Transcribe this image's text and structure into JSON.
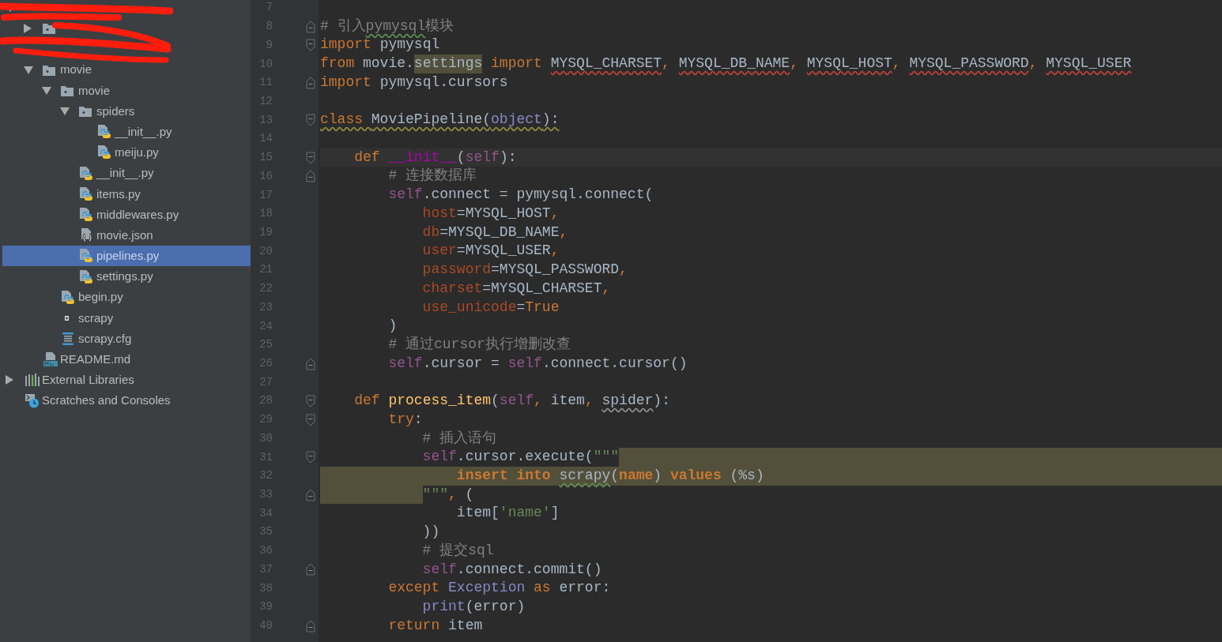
{
  "sidebar": {
    "redacted": true,
    "tree": [
      {
        "kind": "redacted",
        "expanded": true,
        "children": [
          {
            "kind": "folder",
            "expanded": false
          },
          {
            "kind": "redacted"
          },
          {
            "kind": "folder",
            "label": "movie",
            "expanded": true,
            "selected": false,
            "children": [
              {
                "kind": "folder",
                "label": "movie",
                "expanded": true,
                "selected": false,
                "children": [
                  {
                    "kind": "folder",
                    "label": "spiders",
                    "expanded": true,
                    "selected": false,
                    "children": [
                      {
                        "kind": "python",
                        "label": "__init__.py",
                        "selected": false
                      },
                      {
                        "kind": "python",
                        "label": "meiju.py",
                        "selected": false
                      }
                    ]
                  },
                  {
                    "kind": "python",
                    "label": "__init__.py",
                    "selected": false
                  },
                  {
                    "kind": "python",
                    "label": "items.py",
                    "selected": false
                  },
                  {
                    "kind": "python",
                    "label": "middlewares.py",
                    "selected": false
                  },
                  {
                    "kind": "json",
                    "label": "movie.json",
                    "selected": false
                  },
                  {
                    "kind": "python",
                    "label": "pipelines.py",
                    "selected": true
                  },
                  {
                    "kind": "python",
                    "label": "settings.py",
                    "selected": false
                  }
                ]
              },
              {
                "kind": "python",
                "label": "begin.py",
                "selected": false
              },
              {
                "kind": "file",
                "label": "scrapy",
                "selected": false
              },
              {
                "kind": "config",
                "label": "scrapy.cfg",
                "selected": false
              }
            ]
          },
          {
            "kind": "markdown",
            "label": "README.md",
            "selected": false
          }
        ]
      },
      {
        "kind": "libraries",
        "label": "External Libraries",
        "expanded": false,
        "selected": false
      },
      {
        "kind": "scratches",
        "label": "Scratches and Consoles",
        "selected": false
      }
    ]
  },
  "editor": {
    "lines": [
      {
        "number": "7"
      },
      {
        "number": "8",
        "fold_end": true,
        "tokens": [
          {
            "text": "# 引入",
            "kind": "comment"
          },
          {
            "text": "pymysql",
            "kind": "comment",
            "typo": true
          },
          {
            "text": "模块",
            "kind": "comment"
          }
        ]
      },
      {
        "number": "9",
        "fold_start": true,
        "tokens": [
          {
            "text": "import ",
            "kind": "kw"
          },
          {
            "text": "pymysql",
            "kind": "plain"
          }
        ]
      },
      {
        "number": "10",
        "tokens": [
          {
            "text": "from ",
            "kind": "kw"
          },
          {
            "text": "movie.",
            "kind": "plain"
          },
          {
            "text": "settings",
            "kind": "plain",
            "hl": true
          },
          {
            "text": " import ",
            "kind": "kw"
          },
          {
            "text": "MYSQL_CHARSET",
            "kind": "plain",
            "error": true
          },
          {
            "text": ", ",
            "kind": "kw"
          },
          {
            "text": "MYSQL_DB_NAME",
            "kind": "plain",
            "error": true
          },
          {
            "text": ", ",
            "kind": "kw"
          },
          {
            "text": "MYSQL_HOST",
            "kind": "plain",
            "error": true
          },
          {
            "text": ", ",
            "kind": "kw"
          },
          {
            "text": "MYSQL_PASSWORD",
            "kind": "plain",
            "error": true
          },
          {
            "text": ", ",
            "kind": "kw"
          },
          {
            "text": "MYSQL_USER",
            "kind": "plain",
            "error": true
          }
        ]
      },
      {
        "number": "11",
        "fold_end": true,
        "tokens": [
          {
            "text": "import ",
            "kind": "kw"
          },
          {
            "text": "pymysql.cursors",
            "kind": "plain"
          }
        ]
      },
      {
        "number": "12"
      },
      {
        "number": "13",
        "fold_start": true,
        "tokens": [
          {
            "text": "class ",
            "kind": "kw",
            "warning": true
          },
          {
            "text": "MoviePipeline(",
            "kind": "plain",
            "warning": true
          },
          {
            "text": "object",
            "kind": "builtin",
            "warning": true
          },
          {
            "text": "):",
            "kind": "plain",
            "warning": true
          }
        ]
      },
      {
        "number": "14"
      },
      {
        "number": "15",
        "fold_start": true,
        "current": true,
        "tokens": [
          {
            "text": "    def ",
            "kind": "kw"
          },
          {
            "text": "__init__",
            "kind": "magic"
          },
          {
            "text": "(",
            "kind": "plain"
          },
          {
            "text": "self",
            "kind": "self"
          },
          {
            "text": "):",
            "kind": "plain"
          }
        ]
      },
      {
        "number": "16",
        "fold_end": true,
        "tokens": [
          {
            "text": "        # 连接数据库",
            "kind": "comment"
          }
        ]
      },
      {
        "number": "17",
        "tokens": [
          {
            "text": "        self",
            "kind": "self"
          },
          {
            "text": ".connect = pymysql.connect(",
            "kind": "plain"
          }
        ]
      },
      {
        "number": "18",
        "tokens": [
          {
            "text": "            host",
            "kind": "param"
          },
          {
            "text": "=MYSQL_HOST",
            "kind": "plain"
          },
          {
            "text": ",",
            "kind": "kw"
          }
        ]
      },
      {
        "number": "19",
        "tokens": [
          {
            "text": "            db",
            "kind": "param"
          },
          {
            "text": "=MYSQL_DB_NAME",
            "kind": "plain"
          },
          {
            "text": ",",
            "kind": "kw"
          }
        ]
      },
      {
        "number": "20",
        "tokens": [
          {
            "text": "            user",
            "kind": "param"
          },
          {
            "text": "=MYSQL_USER",
            "kind": "plain"
          },
          {
            "text": ",",
            "kind": "kw"
          }
        ]
      },
      {
        "number": "21",
        "tokens": [
          {
            "text": "            password",
            "kind": "param"
          },
          {
            "text": "=MYSQL_PASSWORD",
            "kind": "plain"
          },
          {
            "text": ",",
            "kind": "kw"
          }
        ]
      },
      {
        "number": "22",
        "tokens": [
          {
            "text": "            charset",
            "kind": "param"
          },
          {
            "text": "=MYSQL_CHARSET",
            "kind": "plain"
          },
          {
            "text": ",",
            "kind": "kw"
          }
        ]
      },
      {
        "number": "23",
        "tokens": [
          {
            "text": "            use_unicode",
            "kind": "param"
          },
          {
            "text": "=",
            "kind": "plain"
          },
          {
            "text": "True",
            "kind": "kw"
          }
        ]
      },
      {
        "number": "24",
        "tokens": [
          {
            "text": "        )",
            "kind": "plain"
          }
        ]
      },
      {
        "number": "25",
        "tokens": [
          {
            "text": "        # 通过cursor执行增删改查",
            "kind": "comment"
          }
        ]
      },
      {
        "number": "26",
        "fold_end": true,
        "tokens": [
          {
            "text": "        self",
            "kind": "self"
          },
          {
            "text": ".cursor = ",
            "kind": "plain"
          },
          {
            "text": "self",
            "kind": "self"
          },
          {
            "text": ".connect.cursor()",
            "kind": "plain"
          }
        ]
      },
      {
        "number": "27"
      },
      {
        "number": "28",
        "fold_start": true,
        "tokens": [
          {
            "text": "    def ",
            "kind": "kw"
          },
          {
            "text": "process_item",
            "kind": "fn"
          },
          {
            "text": "(",
            "kind": "plain"
          },
          {
            "text": "self",
            "kind": "self"
          },
          {
            "text": ", ",
            "kind": "kw"
          },
          {
            "text": "item",
            "kind": "plain"
          },
          {
            "text": ", ",
            "kind": "kw"
          },
          {
            "text": "spider",
            "kind": "plain",
            "weak_warning": true
          },
          {
            "text": "):",
            "kind": "plain"
          }
        ]
      },
      {
        "number": "29",
        "fold_start": true,
        "tokens": [
          {
            "text": "        try",
            "kind": "kw"
          },
          {
            "text": ":",
            "kind": "plain"
          }
        ]
      },
      {
        "number": "30",
        "tokens": [
          {
            "text": "            # 插入语句",
            "kind": "comment"
          }
        ]
      },
      {
        "number": "31",
        "fold_start": true,
        "highlight_after": true,
        "tokens": [
          {
            "text": "            self",
            "kind": "self"
          },
          {
            "text": ".cursor.execute(",
            "kind": "plain"
          },
          {
            "text": "\"\"\"",
            "kind": "str"
          }
        ]
      },
      {
        "number": "32",
        "highlighted": true,
        "tokens": [
          {
            "text": "                insert into ",
            "kind": "sql"
          },
          {
            "text": "scrapy",
            "kind": "plain",
            "typo": true
          },
          {
            "text": "(",
            "kind": "plain"
          },
          {
            "text": "name",
            "kind": "sql"
          },
          {
            "text": ") ",
            "kind": "plain"
          },
          {
            "text": "values",
            "kind": "sql"
          },
          {
            "text": " (%s)",
            "kind": "plain"
          }
        ]
      },
      {
        "number": "33",
        "fold_end": true,
        "highlight_indent": true,
        "tokens": [
          {
            "text": "            \"\"\"",
            "kind": "str"
          },
          {
            "text": ", ",
            "kind": "kw"
          },
          {
            "text": "(",
            "kind": "plain"
          }
        ]
      },
      {
        "number": "34",
        "tokens": [
          {
            "text": "                item[",
            "kind": "plain"
          },
          {
            "text": "'name'",
            "kind": "str"
          },
          {
            "text": "]",
            "kind": "plain"
          }
        ]
      },
      {
        "number": "35",
        "tokens": [
          {
            "text": "            ))",
            "kind": "plain"
          }
        ]
      },
      {
        "number": "36",
        "tokens": [
          {
            "text": "            # 提交sql",
            "kind": "comment"
          }
        ]
      },
      {
        "number": "37",
        "fold_end": true,
        "tokens": [
          {
            "text": "            self",
            "kind": "self"
          },
          {
            "text": ".connect.commit()",
            "kind": "plain"
          }
        ]
      },
      {
        "number": "38",
        "tokens": [
          {
            "text": "        except ",
            "kind": "kw"
          },
          {
            "text": "Exception",
            "kind": "builtin"
          },
          {
            "text": " as ",
            "kind": "kw"
          },
          {
            "text": "error:",
            "kind": "plain"
          }
        ]
      },
      {
        "number": "39",
        "tokens": [
          {
            "text": "            print",
            "kind": "builtin"
          },
          {
            "text": "(error)",
            "kind": "plain"
          }
        ]
      },
      {
        "number": "40",
        "fold_end": true,
        "tokens": [
          {
            "text": "        return ",
            "kind": "kw"
          },
          {
            "text": "item",
            "kind": "plain"
          }
        ]
      }
    ]
  }
}
